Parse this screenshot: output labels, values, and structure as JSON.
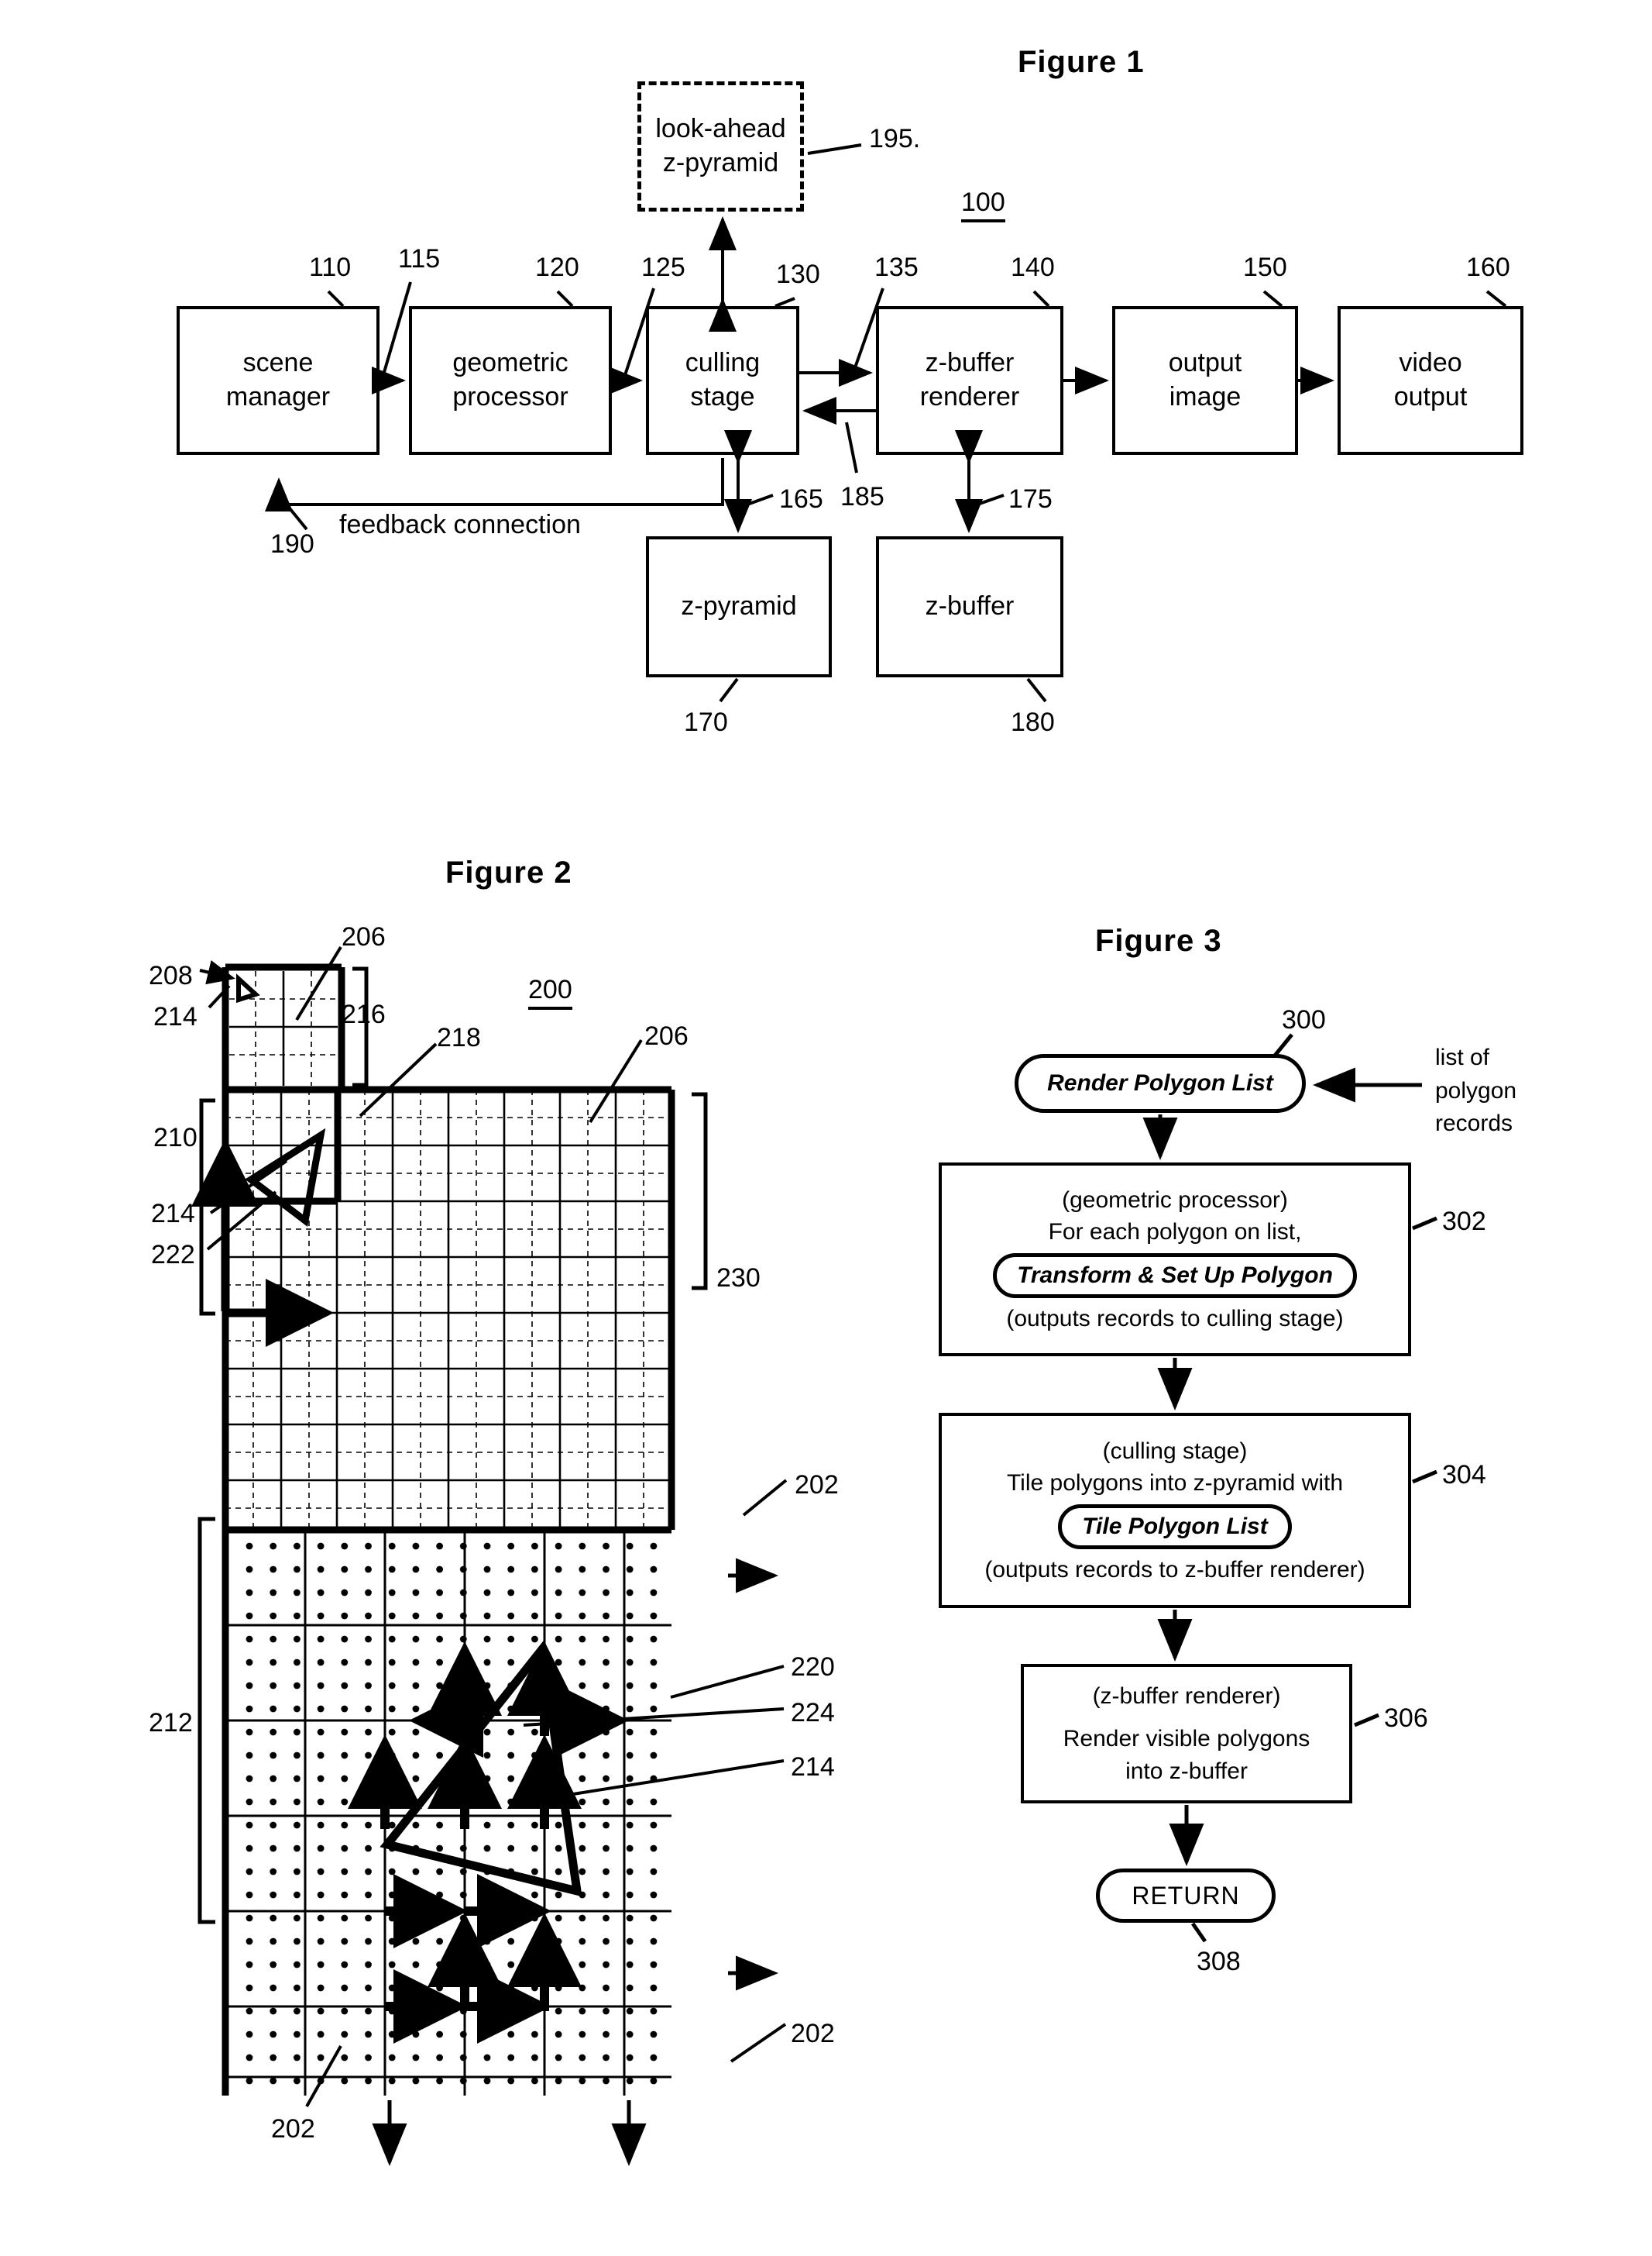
{
  "figure1": {
    "title": "Figure  1",
    "system_ref": "100",
    "boxes": [
      {
        "id": "scene-manager",
        "label": "scene\nmanager",
        "ref": "110"
      },
      {
        "id": "geometric-processor",
        "label": "geometric\nprocessor",
        "ref": "120"
      },
      {
        "id": "culling-stage",
        "label": "culling\nstage",
        "ref": "130"
      },
      {
        "id": "z-buffer-renderer",
        "label": "z-buffer\nrenderer",
        "ref": "140"
      },
      {
        "id": "output-image",
        "label": "output\nimage",
        "ref": "150"
      },
      {
        "id": "video-output",
        "label": "video\noutput",
        "ref": "160"
      },
      {
        "id": "z-pyramid",
        "label": "z-pyramid",
        "ref": "170"
      },
      {
        "id": "z-buffer",
        "label": "z-buffer",
        "ref": "180"
      },
      {
        "id": "look-ahead-z-pyramid",
        "label": "look-ahead\nz-pyramid",
        "ref": "195"
      }
    ],
    "connector_refs": [
      "115",
      "125",
      "135",
      "165",
      "185",
      "175",
      "190"
    ],
    "feedback_label": "feedback  connection",
    "box_text": {
      "scene_manager_l1": "scene",
      "scene_manager_l2": "manager",
      "geometric_processor_l1": "geometric",
      "geometric_processor_l2": "processor",
      "culling_stage_l1": "culling",
      "culling_stage_l2": "stage",
      "z_buffer_renderer_l1": "z-buffer",
      "z_buffer_renderer_l2": "renderer",
      "output_image_l1": "output",
      "output_image_l2": "image",
      "video_output_l1": "video",
      "video_output_l2": "output",
      "z_pyramid": "z-pyramid",
      "z_buffer": "z-buffer",
      "look_ahead_l1": "look-ahead",
      "look_ahead_l2": "z-pyramid"
    },
    "refs": {
      "r110": "110",
      "r115": "115",
      "r120": "120",
      "r125": "125",
      "r130": "130",
      "r135": "135",
      "r140": "140",
      "r150": "150",
      "r160": "160",
      "r165": "165",
      "r170": "170",
      "r175": "175",
      "r180": "180",
      "r185": "185",
      "r190": "190",
      "r195": "195."
    }
  },
  "figure2": {
    "title": "Figure  2",
    "system_ref": "200",
    "refs": {
      "r202a": "202",
      "r202b": "202",
      "r202c": "202",
      "r206a": "206",
      "r206b": "206",
      "r208": "208",
      "r210": "210",
      "r212": "212",
      "r214a": "214",
      "r214b": "214",
      "r214c": "214",
      "r216": "216",
      "r218": "218",
      "r220": "220",
      "r222": "222",
      "r224": "224",
      "r230": "230"
    }
  },
  "figure3": {
    "title": "Figure  3",
    "side_note": {
      "line1": "list of",
      "line2": "polygon",
      "line3": "records"
    },
    "nodes": [
      {
        "id": "start",
        "kind": "pill",
        "text": "Render Polygon List",
        "ref": "300"
      },
      {
        "id": "step302",
        "kind": "box",
        "ref": "302",
        "line1": "(geometric processor)",
        "line2": "For each polygon on list,",
        "pill": "Transform & Set Up Polygon",
        "line3": "(outputs records to culling stage)"
      },
      {
        "id": "step304",
        "kind": "box",
        "ref": "304",
        "line1": "(culling stage)",
        "line2": "Tile polygons into z-pyramid with",
        "pill": "Tile Polygon List",
        "line3": "(outputs records to z-buffer renderer)"
      },
      {
        "id": "step306",
        "kind": "box",
        "ref": "306",
        "line1": "(z-buffer renderer)",
        "line2": "Render visible polygons",
        "line3": "into z-buffer"
      },
      {
        "id": "return",
        "kind": "pill",
        "text": "RETURN",
        "ref": "308"
      }
    ],
    "refs": {
      "r300": "300",
      "r302": "302",
      "r304": "304",
      "r306": "306",
      "r308": "308"
    }
  },
  "colors": {
    "ink": "#000000",
    "paper": "#ffffff"
  }
}
